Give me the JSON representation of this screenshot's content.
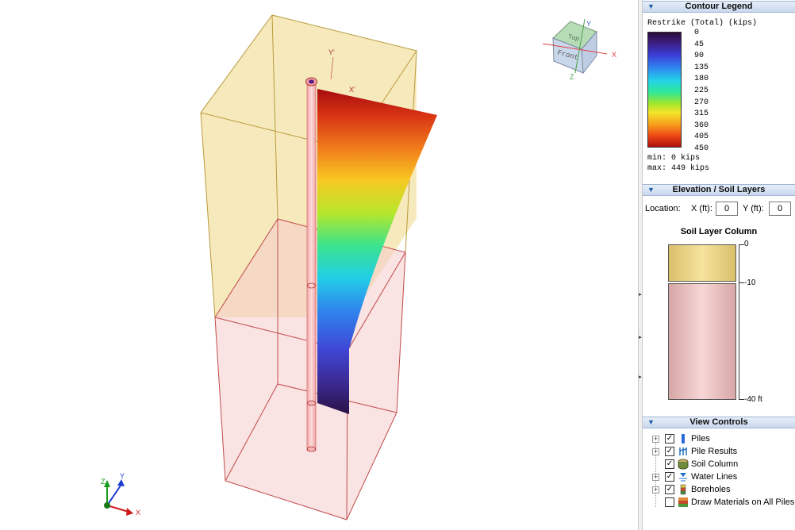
{
  "viewport": {
    "cube": {
      "top_label": "Top",
      "front_label": "Front",
      "x_label": "X",
      "y_label": "Y",
      "z_label": "Z"
    },
    "pile_axis_labels": {
      "y_prime": "Y'",
      "x_prime": "X'"
    },
    "triad": {
      "x": "X",
      "y": "Y",
      "z": "Z"
    }
  },
  "contour_legend": {
    "header": "Contour Legend",
    "title": "Restrike (Total) (kips)",
    "ticks": [
      "0",
      "45",
      "90",
      "135",
      "180",
      "225",
      "270",
      "315",
      "360",
      "405",
      "450"
    ],
    "min_text": "min: 0 kips",
    "max_text": "max: 449 kips"
  },
  "elevation": {
    "header": "Elevation / Soil Layers",
    "location_label": "Location:",
    "x_label": "X (ft):",
    "x_value": "0",
    "y_label": "Y (ft):",
    "y_value": "0",
    "soil_title": "Soil Layer Column",
    "ticks": [
      "0",
      "-10",
      "-40 ft"
    ],
    "layer_colors": [
      "#f3dc8e",
      "#f3c9c9"
    ]
  },
  "view_controls": {
    "header": "View Controls",
    "items": [
      {
        "label": "Piles",
        "checked": true,
        "expandable": true,
        "icon": "pile-icon"
      },
      {
        "label": "Pile Results",
        "checked": true,
        "expandable": true,
        "icon": "pile-results-icon"
      },
      {
        "label": "Soil Column",
        "checked": true,
        "expandable": false,
        "icon": "soil-column-icon"
      },
      {
        "label": "Water Lines",
        "checked": true,
        "expandable": true,
        "icon": "water-lines-icon"
      },
      {
        "label": "Boreholes",
        "checked": true,
        "expandable": true,
        "icon": "boreholes-icon"
      },
      {
        "label": "Draw Materials on All Piles",
        "checked": false,
        "expandable": false,
        "icon": "materials-icon"
      }
    ]
  },
  "colors": {
    "panel_header": "#c9d8ee",
    "accent": "#1f5fa8",
    "soil_top": "#f3dc8e",
    "soil_bottom": "#f3c9c9"
  }
}
